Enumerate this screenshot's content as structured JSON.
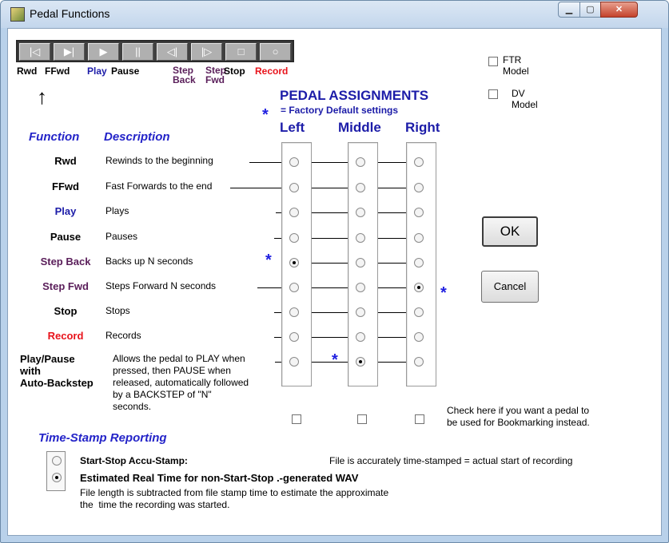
{
  "window": {
    "title": "Pedal Functions",
    "controls": {
      "minimize": "▁",
      "maximize": "▢",
      "close": "✕"
    }
  },
  "toolbar": {
    "buttons": [
      {
        "glyph": "|◁"
      },
      {
        "glyph": "▶|"
      },
      {
        "glyph": "▶"
      },
      {
        "glyph": "||"
      },
      {
        "glyph": "◁|"
      },
      {
        "glyph": "|▷"
      },
      {
        "glyph": "□"
      },
      {
        "glyph": "○"
      }
    ],
    "labels": {
      "rwd": "Rwd",
      "ffwd": "FFwd",
      "play": "Play",
      "pause": "Pause",
      "step_back": "Step\nBack",
      "step_fwd": "Step\nFwd",
      "stop": "Stop",
      "record": "Record"
    },
    "arrow": "↑"
  },
  "models": {
    "ftr": "FTR\nModel",
    "dv": "DV\nModel"
  },
  "assignments": {
    "title": "PEDAL ASSIGNMENTS",
    "star": "*",
    "factory_note": "= Factory Default settings",
    "columns": [
      "Left",
      "Middle",
      "Right"
    ]
  },
  "headers": {
    "function": "Function",
    "description": "Description"
  },
  "rows": [
    {
      "name": "Rwd",
      "desc": "Rewinds to the beginning",
      "color": "#000000",
      "selected": -1
    },
    {
      "name": "FFwd",
      "desc": "Fast Forwards to the end",
      "color": "#000000",
      "selected": -1
    },
    {
      "name": "Play",
      "desc": "Plays",
      "color": "#1c1ca8",
      "selected": -1
    },
    {
      "name": "Pause",
      "desc": "Pauses",
      "color": "#000000",
      "selected": -1
    },
    {
      "name": "Step Back",
      "desc": "Backs up N seconds",
      "color": "#5a1e5a",
      "selected": 0
    },
    {
      "name": "Step Fwd",
      "desc": "Steps Forward N seconds",
      "color": "#5a1e5a",
      "selected": 2
    },
    {
      "name": "Stop",
      "desc": "Stops",
      "color": "#000000",
      "selected": -1
    },
    {
      "name": "Record",
      "desc": "Records",
      "color": "#e8121a",
      "selected": -1
    },
    {
      "name": "Play/Pause\nwith\nAuto-Backstep",
      "desc": "Allows the pedal to PLAY when\npressed, then PAUSE when\nreleased, automatically followed\nby a BACKSTEP of \"N\"\nseconds.",
      "color": "#000000",
      "selected": 1
    }
  ],
  "bookmark_note": "Check here if you want a pedal to\nbe used for Bookmarking instead.",
  "buttons": {
    "ok": "OK",
    "cancel": "Cancel"
  },
  "timestamp": {
    "title": "Time-Stamp Reporting",
    "option1": "Start-Stop  Accu-Stamp:",
    "option1_note": "File is accurately time-stamped = actual start of recording",
    "option2": "Estimated Real Time for non-Start-Stop .-generated  WAV",
    "option2_note": "File length is subtracted from file stamp time to estimate the approximate\nthe  time the recording was started.",
    "selected": 2
  }
}
